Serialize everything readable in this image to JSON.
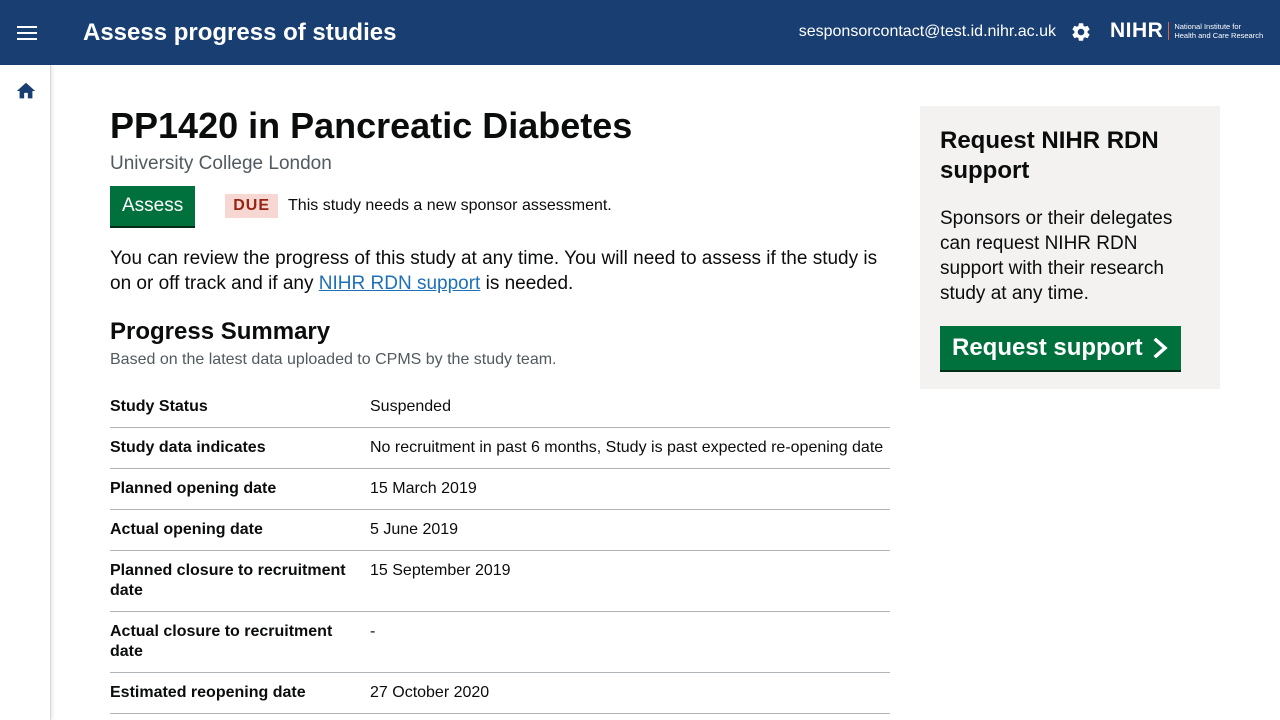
{
  "header": {
    "title": "Assess progress of studies",
    "user_email": "sesponsorcontact@test.id.nihr.ac.uk",
    "logo": {
      "word": "NIHR",
      "line1": "National Institute for",
      "line2": "Health and Care Research"
    }
  },
  "icons": {
    "menu": "menu-icon",
    "settings": "gear-icon",
    "home": "home-icon",
    "chevron": "chevron-right-icon"
  },
  "colors": {
    "header_bg": "#193e72",
    "primary_button": "#00703c",
    "link": "#1d70b8",
    "due_tag_bg": "#f6d7d2",
    "due_tag_text": "#942514",
    "aside_bg": "#f3f2f1"
  },
  "study": {
    "title": "PP1420 in Pancreatic Diabetes",
    "organisation": "University College London",
    "assess_label": "Assess",
    "due_label": "DUE",
    "due_text": "This study needs a new sponsor assessment.",
    "intro_before": "You can review the progress of this study at any time. You will need to assess if the study is on or off track and if any ",
    "intro_link": "NIHR RDN support",
    "intro_after": " is needed."
  },
  "summary": {
    "title": "Progress Summary",
    "subtitle": "Based on the latest data uploaded to CPMS by the study team.",
    "rows": [
      {
        "key": "Study Status",
        "value": "Suspended"
      },
      {
        "key": "Study data indicates",
        "value": "No recruitment in past 6 months, Study is past expected re-opening date"
      },
      {
        "key": "Planned opening date",
        "value": "15 March 2019"
      },
      {
        "key": "Actual opening date",
        "value": "5 June 2019"
      },
      {
        "key": "Planned closure to recruitment date",
        "value": "15 September 2019"
      },
      {
        "key": "Actual closure to recruitment date",
        "value": "-"
      },
      {
        "key": "Estimated reopening date",
        "value": "27 October 2020"
      }
    ]
  },
  "aside": {
    "title": "Request NIHR RDN support",
    "text": "Sponsors or their delegates can request NIHR RDN support with their research study at any time.",
    "button_label": "Request support"
  }
}
